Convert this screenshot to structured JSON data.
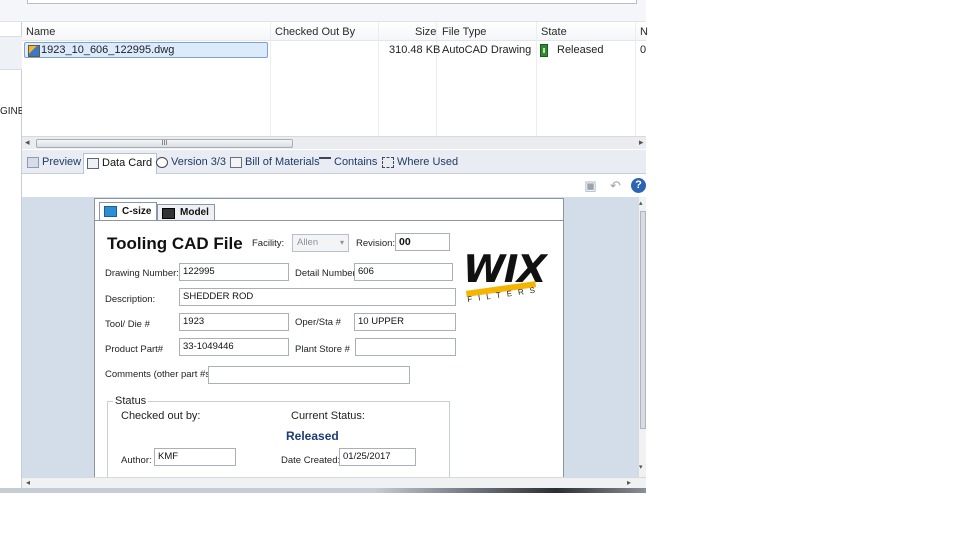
{
  "left_pane": {
    "label": "GINEI"
  },
  "grid": {
    "columns": [
      "Name",
      "Checked Out By",
      "Size",
      "File Type",
      "State",
      "N"
    ],
    "rows": [
      {
        "name": "1923_10_606_122995.dwg",
        "checked_out_by": "",
        "size": "310.48 KB",
        "file_type": "AutoCAD Drawing",
        "state": "Released",
        "extra": "0"
      }
    ],
    "scroll_thumb_grip": "III"
  },
  "tabs": [
    "Preview",
    "Data Card",
    "Version 3/3",
    "Bill of Materials",
    "Contains",
    "Where Used"
  ],
  "active_tab": "Data Card",
  "toolbar": {
    "help": "?"
  },
  "card": {
    "tabs": [
      "C-size",
      "Model"
    ],
    "title": "Tooling CAD File",
    "facility_label": "Facility:",
    "facility_value": "Allen",
    "revision_label": "Revision:",
    "revision_value": "00",
    "drawing_number_label": "Drawing Number:",
    "drawing_number": "122995",
    "detail_number_label": "Detail Number:",
    "detail_number": "606",
    "description_label": "Description:",
    "description": "SHEDDER ROD",
    "tool_die_label": "Tool/ Die #",
    "tool_die": "1923",
    "oper_sta_label": "Oper/Sta #",
    "oper_sta": "10 UPPER",
    "product_part_label": "Product Part#",
    "product_part": "33-1049446",
    "plant_store_label": "Plant Store #",
    "plant_store": "",
    "comments_label": "Comments (other part #s)",
    "comments": "",
    "logo": {
      "word": "WIX",
      "sub": "FILTERS"
    },
    "status": {
      "legend": "Status",
      "checked_out_label": "Checked out by:",
      "current_status_label": "Current Status:",
      "current_status": "Released",
      "author_label": "Author:",
      "author": "KMF",
      "date_created_label": "Date Created:",
      "date_created": "01/25/2017"
    }
  }
}
